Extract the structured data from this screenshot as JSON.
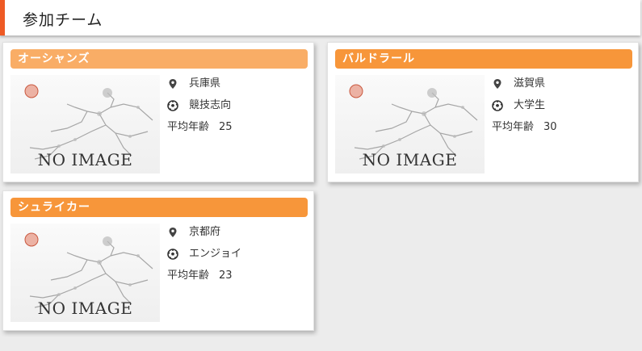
{
  "section": {
    "title": "参加チーム"
  },
  "age_label": "平均年齢",
  "no_image_text": "NO IMAGE",
  "colors": {
    "accent": "#ee5a24",
    "team_header_light": "#f9ad66",
    "team_header": "#f7963a"
  },
  "teams": [
    {
      "name": "オーシャンズ",
      "prefecture": "兵庫県",
      "level": "競技志向",
      "avg_age": "25"
    },
    {
      "name": "バルドラール",
      "prefecture": "滋賀県",
      "level": "大学生",
      "avg_age": "30"
    },
    {
      "name": "シュライカー",
      "prefecture": "京都府",
      "level": "エンジョイ",
      "avg_age": "23"
    }
  ]
}
